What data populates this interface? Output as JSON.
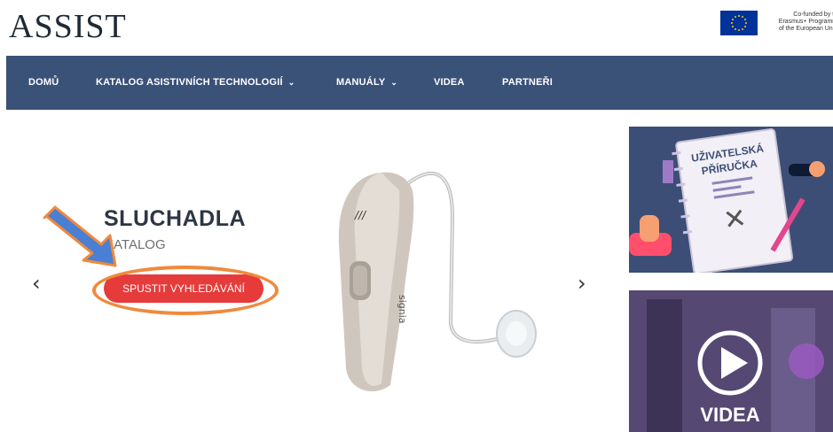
{
  "header": {
    "logo": "ASSIST",
    "eu_line1": "Co-funded by the",
    "eu_line2": "Erasmus+ Programme",
    "eu_line3": "of the European Union",
    "eu_flag_icon": "eu-flag-icon"
  },
  "nav": {
    "items": [
      {
        "label": "DOMŮ",
        "has_dropdown": false
      },
      {
        "label": "KATALOG ASISTIVNÍCH TECHNOLOGIÍ",
        "has_dropdown": true
      },
      {
        "label": "MANUÁLY",
        "has_dropdown": true
      },
      {
        "label": "VIDEA",
        "has_dropdown": false
      },
      {
        "label": "PARTNEŘI",
        "has_dropdown": false
      }
    ],
    "background": "#3a5178"
  },
  "slider": {
    "title": "SLUCHADLA",
    "subtitle": "KATALOG",
    "cta_label": "SPUSTIT VYHLEDÁVÁNÍ",
    "prev_glyph": "‹",
    "next_glyph": "›",
    "cta_color": "#e53b3b",
    "highlight_color": "#ef8a3c",
    "pointer_color": "#4a7fd4",
    "product_brand": "signia",
    "product_mark": "///"
  },
  "tiles": {
    "manual_title_line1": "UŽIVATELSKÁ",
    "manual_title_line2": "PŘÍRUČKA",
    "video_label": "VIDEA",
    "play_icon": "play-icon"
  }
}
